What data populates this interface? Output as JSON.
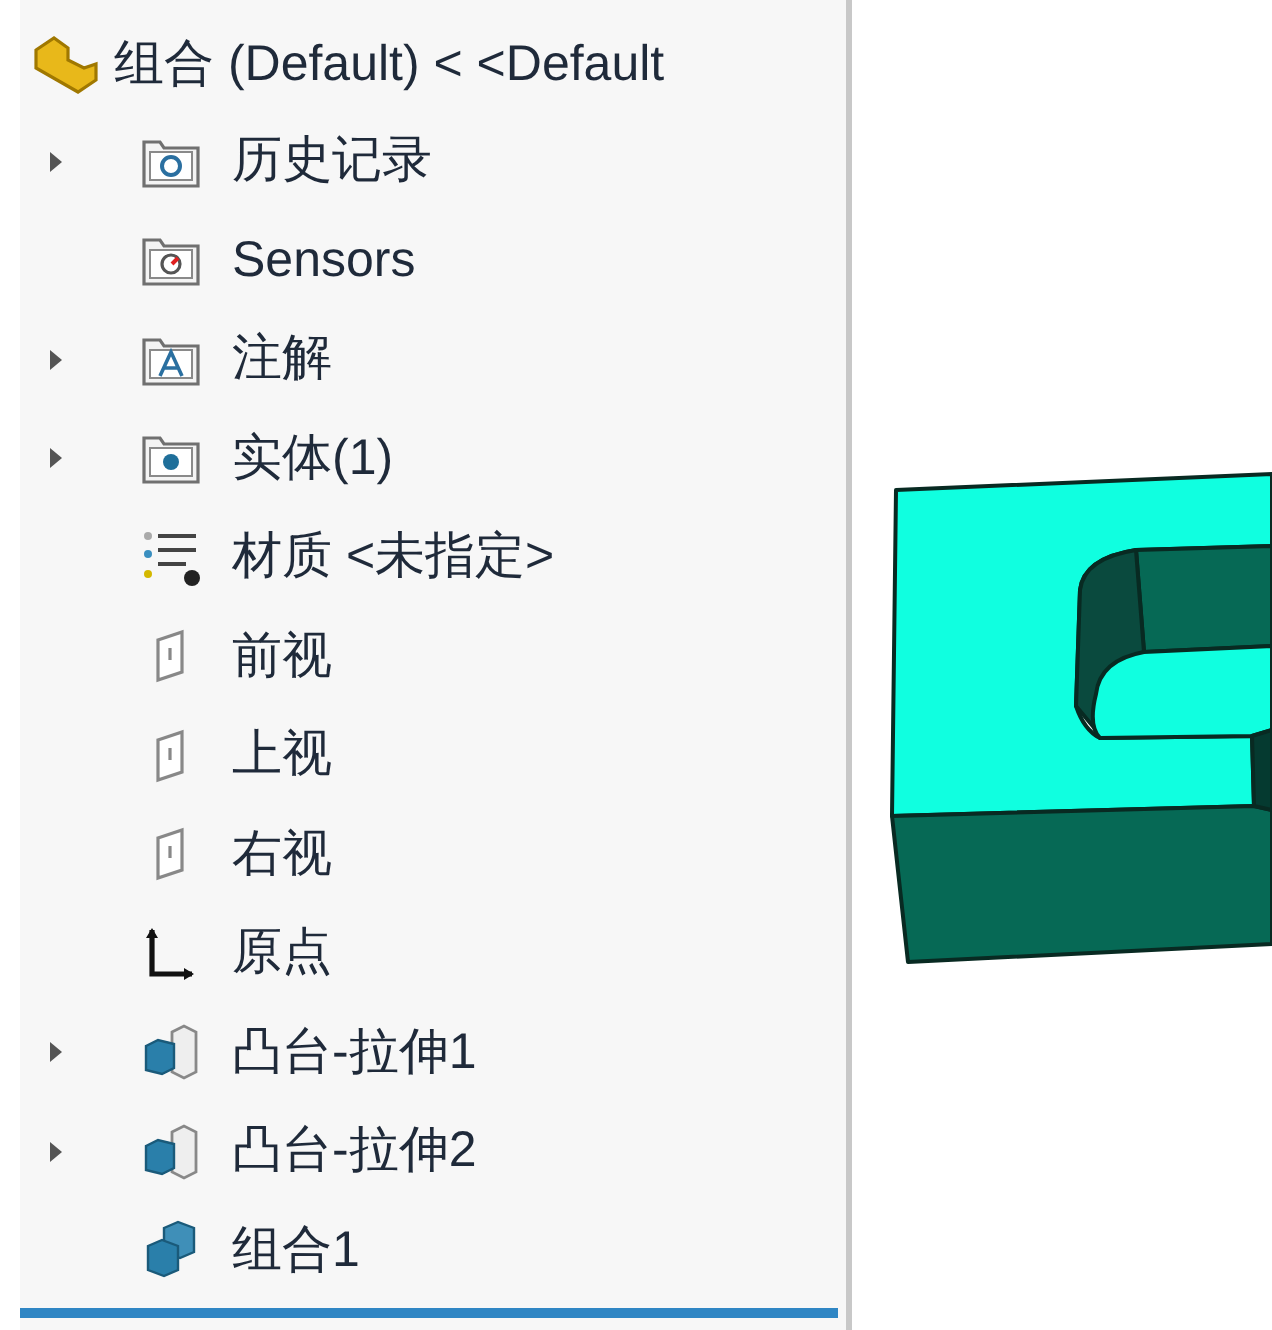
{
  "tree": {
    "root": {
      "label": "组合 (Default) < <Default"
    },
    "items": [
      {
        "kind": "history",
        "label": "历史记录",
        "expandable": true
      },
      {
        "kind": "sensors",
        "label": "Sensors",
        "expandable": false
      },
      {
        "kind": "annotations",
        "label": "注解",
        "expandable": true
      },
      {
        "kind": "solid",
        "label": "实体(1)",
        "expandable": true
      },
      {
        "kind": "material",
        "label": "材质 <未指定>",
        "expandable": false
      },
      {
        "kind": "plane",
        "label": "前视",
        "expandable": false
      },
      {
        "kind": "plane",
        "label": "上视",
        "expandable": false
      },
      {
        "kind": "plane",
        "label": "右视",
        "expandable": false
      },
      {
        "kind": "origin",
        "label": "原点",
        "expandable": false
      },
      {
        "kind": "extrude",
        "label": "凸台-拉伸1",
        "expandable": true
      },
      {
        "kind": "extrude",
        "label": "凸台-拉伸2",
        "expandable": true
      },
      {
        "kind": "combine",
        "label": "组合1",
        "expandable": false
      }
    ]
  }
}
